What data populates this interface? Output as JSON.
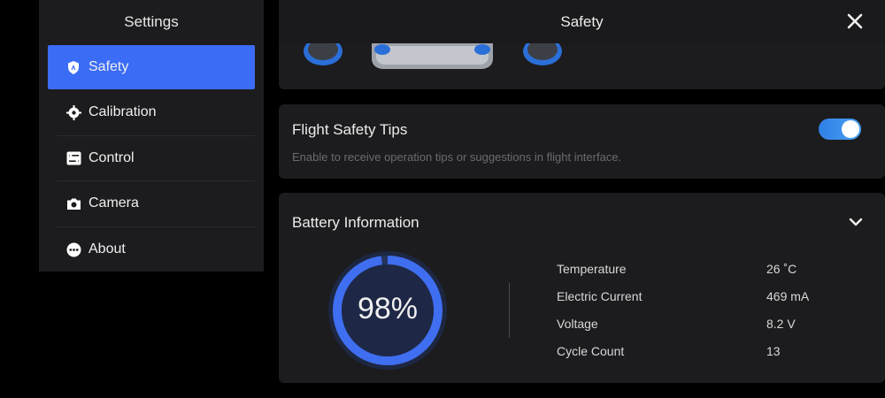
{
  "sidebar": {
    "title": "Settings",
    "items": [
      {
        "label": "Safety",
        "icon": "shield-icon",
        "active": true
      },
      {
        "label": "Calibration",
        "icon": "calibration-icon",
        "active": false
      },
      {
        "label": "Control",
        "icon": "control-icon",
        "active": false
      },
      {
        "label": "Camera",
        "icon": "camera-icon",
        "active": false
      },
      {
        "label": "About",
        "icon": "about-icon",
        "active": false
      }
    ]
  },
  "header": {
    "title": "Safety",
    "close_icon": "close-icon"
  },
  "tips": {
    "title": "Flight Safety Tips",
    "description": "Enable to receive operation tips or suggestions in flight interface.",
    "enabled": true
  },
  "battery": {
    "title": "Battery Information",
    "percent_label": "98%",
    "percent": 98,
    "stats": [
      {
        "label": "Temperature",
        "value": "26 ˚C"
      },
      {
        "label": "Electric Current",
        "value": "469 mA"
      },
      {
        "label": "Voltage",
        "value": "8.2 V"
      },
      {
        "label": "Cycle Count",
        "value": "13"
      }
    ]
  },
  "colors": {
    "accent": "#3b6cf5",
    "toggle": "#3a8ff0",
    "panel": "#1c1c1e",
    "background": "#000000"
  }
}
